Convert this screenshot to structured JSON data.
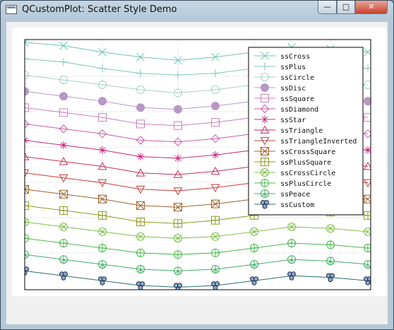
{
  "window": {
    "title": "QCustomPlot: Scatter Style Demo",
    "buttons": {
      "minimize": "—",
      "maximize": "□",
      "close": "✕"
    }
  },
  "chart_data": {
    "type": "scatter",
    "title": "",
    "xlabel": "",
    "ylabel": "",
    "grid": true,
    "legend_position": "top-right",
    "x": [
      0,
      1,
      2,
      3,
      4,
      5,
      6,
      7,
      8,
      9
    ],
    "series": [
      {
        "name": "ssCross",
        "shape": "cross",
        "color": "#6ec2b6",
        "values": [
          14.9,
          14.7,
          14.3,
          14.0,
          13.8,
          14.0,
          14.3,
          14.6,
          14.5,
          14.3
        ]
      },
      {
        "name": "ssPlus",
        "shape": "plus",
        "color": "#82c6bb",
        "values": [
          13.9,
          13.7,
          13.3,
          13.0,
          12.9,
          13.0,
          13.3,
          13.6,
          13.5,
          13.3
        ]
      },
      {
        "name": "ssCircle",
        "shape": "circle",
        "color": "#a8cfc5",
        "values": [
          12.9,
          12.6,
          12.3,
          12.0,
          11.8,
          12.0,
          12.3,
          12.6,
          12.5,
          12.3
        ]
      },
      {
        "name": "ssDisc",
        "shape": "disc",
        "color": "#b898c4",
        "values": [
          11.9,
          11.6,
          11.3,
          10.9,
          10.8,
          11.0,
          11.3,
          11.6,
          11.5,
          11.3
        ]
      },
      {
        "name": "ssSquare",
        "shape": "square",
        "color": "#cc7fb8",
        "values": [
          10.9,
          10.6,
          10.3,
          9.9,
          9.8,
          10.0,
          10.3,
          10.6,
          10.5,
          10.3
        ]
      },
      {
        "name": "ssDiamond",
        "shape": "diamond",
        "color": "#cb5ca6",
        "values": [
          9.9,
          9.6,
          9.3,
          8.9,
          8.8,
          9.0,
          9.3,
          9.6,
          9.5,
          9.3
        ]
      },
      {
        "name": "ssStar",
        "shape": "star",
        "color": "#c8287e",
        "values": [
          8.9,
          8.6,
          8.3,
          7.9,
          7.8,
          8.0,
          8.3,
          8.6,
          8.5,
          8.3
        ]
      },
      {
        "name": "ssTriangle",
        "shape": "triangle",
        "color": "#c82e5c",
        "values": [
          7.9,
          7.6,
          7.3,
          6.9,
          6.8,
          7.0,
          7.3,
          7.6,
          7.5,
          7.3
        ]
      },
      {
        "name": "ssTriangleInverted",
        "shape": "triangleInverted",
        "color": "#c43d3d",
        "values": [
          6.9,
          6.6,
          6.3,
          5.9,
          5.8,
          6.0,
          6.3,
          6.6,
          6.5,
          6.3
        ]
      },
      {
        "name": "ssCrossSquare",
        "shape": "crossSquare",
        "color": "#a0612a",
        "values": [
          5.9,
          5.6,
          5.3,
          4.9,
          4.8,
          5.0,
          5.3,
          5.6,
          5.5,
          5.3
        ]
      },
      {
        "name": "ssPlusSquare",
        "shape": "plusSquare",
        "color": "#8e9a20",
        "values": [
          4.9,
          4.6,
          4.3,
          3.9,
          3.8,
          4.0,
          4.3,
          4.6,
          4.5,
          4.3
        ]
      },
      {
        "name": "ssCrossCircle",
        "shape": "crossCircle",
        "color": "#7ec04a",
        "values": [
          3.9,
          3.6,
          3.3,
          3.0,
          2.9,
          3.0,
          3.3,
          3.6,
          3.5,
          3.3
        ]
      },
      {
        "name": "ssPlusCircle",
        "shape": "plusCircle",
        "color": "#48b84c",
        "values": [
          2.9,
          2.6,
          2.3,
          2.0,
          1.9,
          2.0,
          2.3,
          2.6,
          2.5,
          2.3
        ]
      },
      {
        "name": "ssPeace",
        "shape": "peace",
        "color": "#3fae65",
        "values": [
          1.9,
          1.6,
          1.3,
          1.0,
          0.9,
          1.0,
          1.3,
          1.6,
          1.5,
          1.3
        ]
      },
      {
        "name": "ssCustom",
        "shape": "custom",
        "color": "#2a6e6a",
        "values": [
          0.9,
          0.6,
          0.3,
          0.0,
          -0.1,
          0.0,
          0.3,
          0.6,
          0.5,
          0.3
        ]
      }
    ],
    "xlim": [
      0,
      9
    ],
    "ylim": [
      -0.1,
      15.0
    ]
  }
}
